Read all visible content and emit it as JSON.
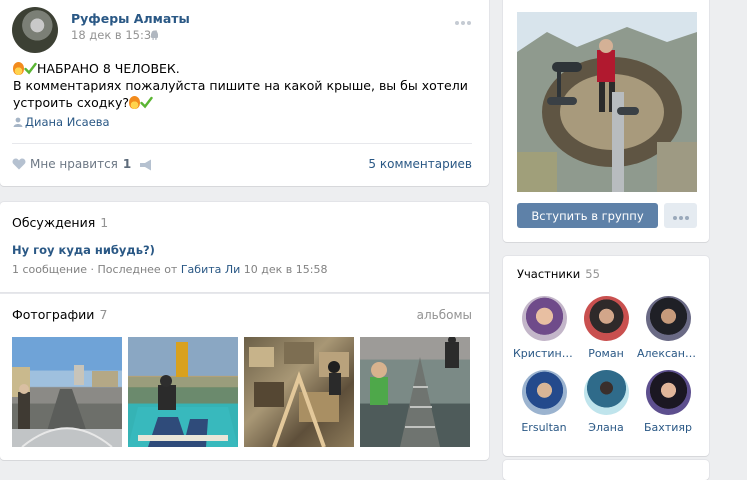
{
  "post": {
    "author": "Руферы Алматы",
    "date": "18 дек в 15:34",
    "text_line1": "НАБРАНО 8 ЧЕЛОВЕК.",
    "text_line2": "В комментариях пожалуйста пишите на какой крыше, вы бы хотели устроить сходку?",
    "signer": "Диана Исаева",
    "like_label": "Мне нравится",
    "like_count": "1",
    "comments_label": "5 комментариев",
    "icons": [
      "android-icon",
      "more-icon",
      "fire-emoji",
      "check-emoji",
      "person-icon",
      "heart-icon",
      "share-icon"
    ]
  },
  "discussions": {
    "title": "Обсуждения",
    "count": "1",
    "topic_title": "Ну гоу куда нибудь?)",
    "topic_msgs": "1 сообщение",
    "topic_last_prefix": " · Последнее от ",
    "topic_last_author": "Габита Ли",
    "topic_last_time": " 10 дек в 15:58"
  },
  "photos": {
    "title": "Фотографии",
    "count": "7",
    "albums_label": "альбомы"
  },
  "group": {
    "join_label": "Вступить в группу"
  },
  "members": {
    "title": "Участники",
    "count": "55",
    "items": [
      {
        "name": "Кристино..."
      },
      {
        "name": "Роман"
      },
      {
        "name": "Александр"
      },
      {
        "name": "Ersultan"
      },
      {
        "name": "Элана"
      },
      {
        "name": "Бахтияр"
      }
    ]
  },
  "colors": {
    "link": "#2a5885",
    "button": "#5e81a8",
    "background": "#edeef0"
  }
}
